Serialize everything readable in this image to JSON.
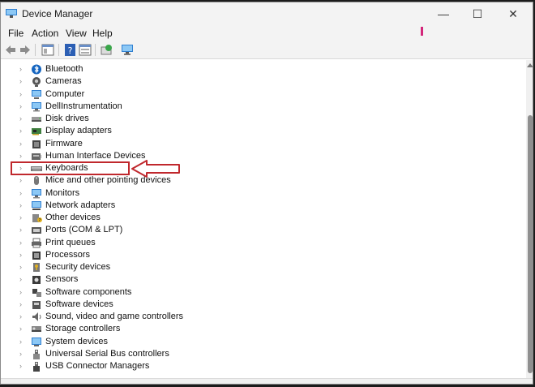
{
  "window": {
    "title": "Device Manager",
    "minimize": "—",
    "maximize": "☐",
    "close": "✕"
  },
  "menu": [
    "File",
    "Action",
    "View",
    "Help"
  ],
  "toolbar": [
    "back-arrow-icon",
    "forward-arrow-icon",
    "properties-icon",
    "help-icon",
    "update-driver-icon",
    "scan-hardware-icon",
    "display-monitor-icon"
  ],
  "devices": [
    {
      "label": "Bluetooth",
      "icon": "bluetooth-icon"
    },
    {
      "label": "Cameras",
      "icon": "camera-icon"
    },
    {
      "label": "Computer",
      "icon": "computer-icon"
    },
    {
      "label": "DellInstrumentation",
      "icon": "monitor-icon"
    },
    {
      "label": "Disk drives",
      "icon": "disk-drive-icon"
    },
    {
      "label": "Display adapters",
      "icon": "display-adapter-icon"
    },
    {
      "label": "Firmware",
      "icon": "firmware-icon"
    },
    {
      "label": "Human Interface Devices",
      "icon": "hid-icon"
    },
    {
      "label": "Keyboards",
      "icon": "keyboard-icon"
    },
    {
      "label": "Mice and other pointing devices",
      "icon": "mouse-icon"
    },
    {
      "label": "Monitors",
      "icon": "monitor-icon"
    },
    {
      "label": "Network adapters",
      "icon": "network-adapter-icon"
    },
    {
      "label": "Other devices",
      "icon": "other-device-icon"
    },
    {
      "label": "Ports (COM & LPT)",
      "icon": "port-icon"
    },
    {
      "label": "Print queues",
      "icon": "printer-icon"
    },
    {
      "label": "Processors",
      "icon": "processor-icon"
    },
    {
      "label": "Security devices",
      "icon": "security-device-icon"
    },
    {
      "label": "Sensors",
      "icon": "sensor-icon"
    },
    {
      "label": "Software components",
      "icon": "software-component-icon"
    },
    {
      "label": "Software devices",
      "icon": "software-device-icon"
    },
    {
      "label": "Sound, video and game controllers",
      "icon": "speaker-icon"
    },
    {
      "label": "Storage controllers",
      "icon": "storage-controller-icon"
    },
    {
      "label": "System devices",
      "icon": "system-device-icon"
    },
    {
      "label": "Universal Serial Bus controllers",
      "icon": "usb-icon"
    },
    {
      "label": "USB Connector Managers",
      "icon": "usb-connector-icon"
    }
  ],
  "highlighted_item": "Keyboards",
  "colors": {
    "highlight": "#c0282d",
    "accent": "#1f7fd8"
  }
}
